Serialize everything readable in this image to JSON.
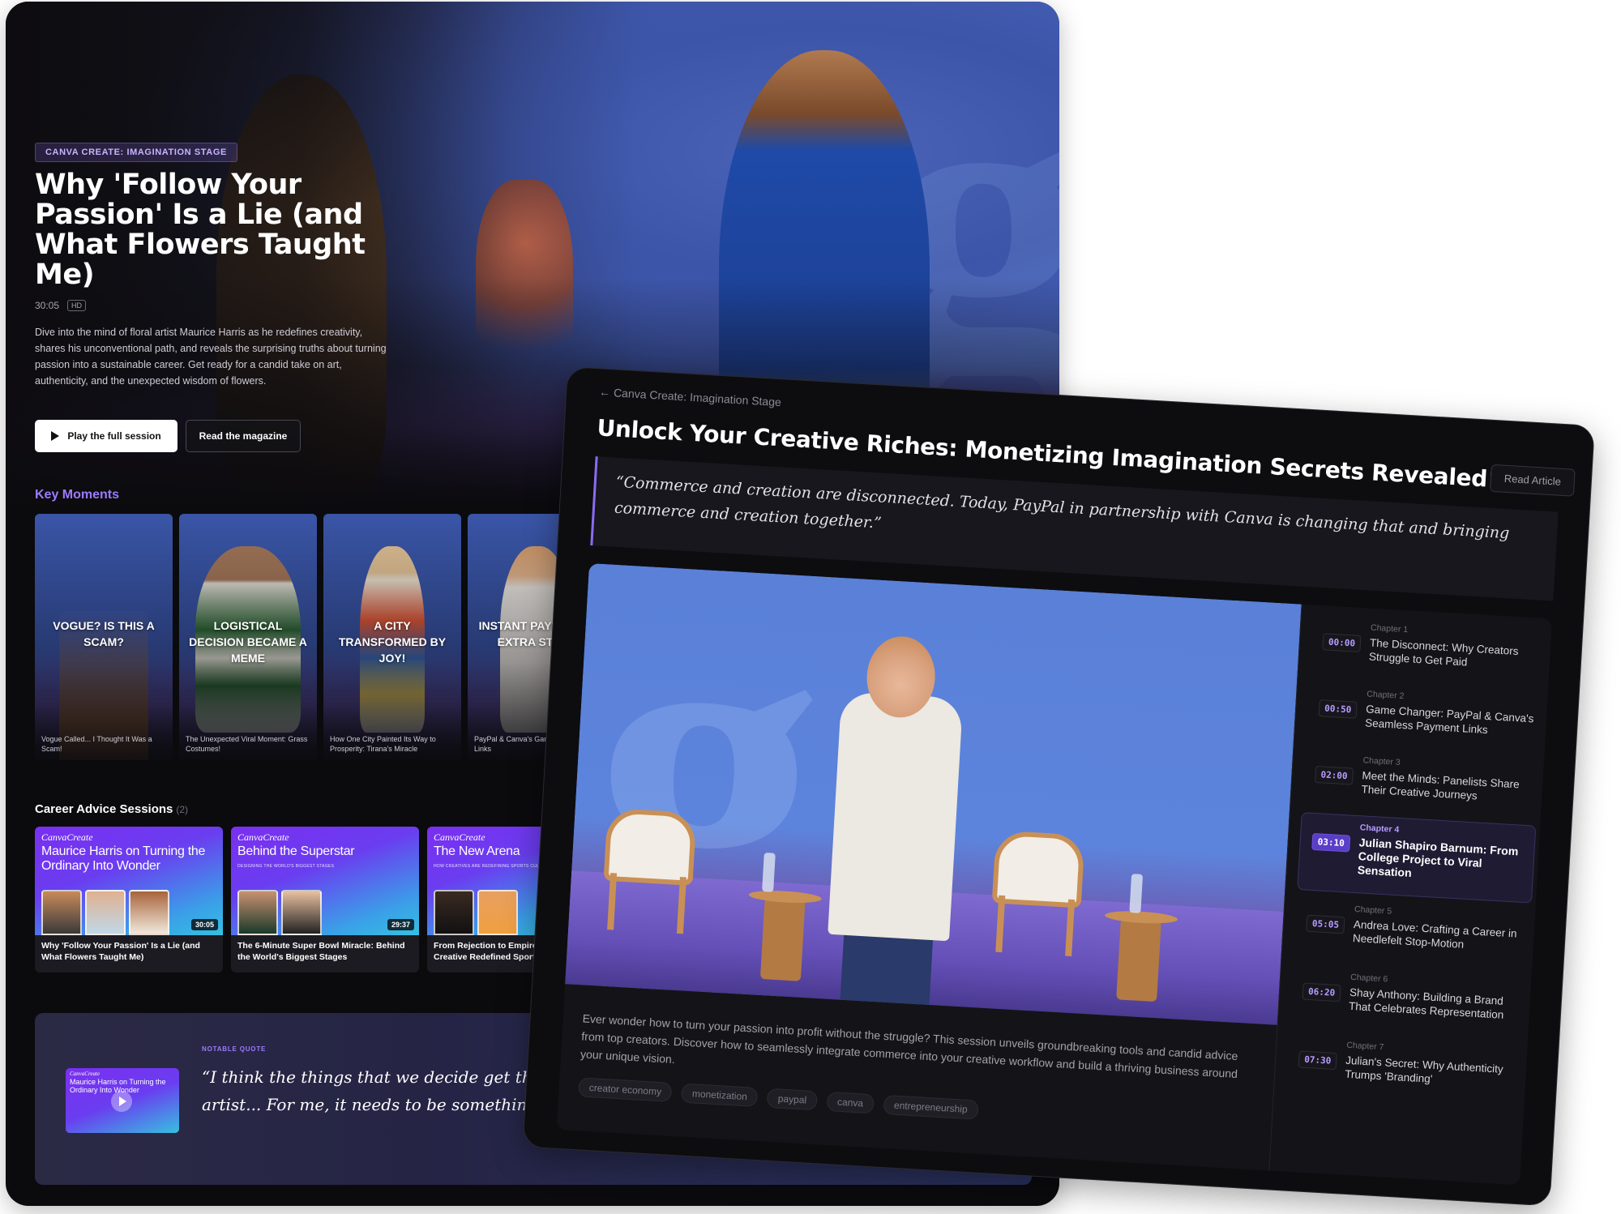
{
  "hero": {
    "tag": "CANVA CREATE: IMAGINATION STAGE",
    "title": "Why 'Follow Your Passion' Is a Lie (and What Flowers Taught Me)",
    "duration": "30:05",
    "quality": "HD",
    "description": "Dive into the mind of floral artist Maurice Harris as he redefines creativity, shares his unconventional path, and reveals the surprising truths about turning passion into a sustainable career. Get ready for a candid take on art, authenticity, and the unexpected wisdom of flowers.",
    "play_label": "Play the full session",
    "magazine_label": "Read the magazine"
  },
  "key_moments": {
    "heading": "Key Moments",
    "items": [
      {
        "title": "Vogue? Is this a scam?",
        "sub": "Vogue Called... I Thought It Was a Scam!"
      },
      {
        "title": "Logistical decision became a meme",
        "sub": "The Unexpected Viral Moment: Grass Costumes!"
      },
      {
        "title": "A city transformed by joy!",
        "sub": "How One City Painted Its Way to Prosperity: Tirana's Miracle"
      },
      {
        "title": "Instant payments, extra steps",
        "sub": "PayPal & Canva's Game Payment Links"
      }
    ]
  },
  "career_sessions": {
    "heading": "Career Advice Sessions",
    "count": "(2)",
    "items": [
      {
        "brand": "CanvaCreate",
        "thumb_title": "Maurice Harris on Turning the Ordinary Into Wonder",
        "thumb_sub": "",
        "duration": "30:05",
        "title": "Why 'Follow Your Passion' Is a Lie (and What Flowers Taught Me)"
      },
      {
        "brand": "CanvaCreate",
        "thumb_title": "Behind the Superstar",
        "thumb_sub": "DESIGNING THE WORLD'S BIGGEST STAGES",
        "duration": "29:37",
        "title": "The 6-Minute Super Bowl Miracle: Behind the World's Biggest Stages"
      },
      {
        "brand": "CanvaCreate",
        "thumb_title": "The New Arena",
        "thumb_sub": "HOW CREATIVES ARE REDEFINING SPORTS CULTURE",
        "duration": "",
        "title": "From Rejection to Empire: Creative Redefined Sports"
      }
    ]
  },
  "notable_quote": {
    "label": "NOTABLE QUOTE",
    "thumb_brand": "CanvaCreate",
    "thumb_title": "Maurice Harris on Turning the Ordinary Into Wonder",
    "text_line1": "“I think the things that we decide get the attention",
    "text_line2": "artist... For me, it needs to be something that"
  },
  "article": {
    "back_link": "← Canva Create: Imagination Stage",
    "title": "Unlock Your Creative Riches: Monetizing Imagination Secrets Revealed!",
    "read_article_label": "Read Article",
    "quote": "“Commerce and creation are disconnected. Today, PayPal in partnership with Canva is changing that and bringing commerce and creation together.”",
    "description": "Ever wonder how to turn your passion into profit without the struggle? This session unveils groundbreaking tools and candid advice from top creators. Discover how to seamlessly integrate commerce into your creative workflow and build a thriving business around your unique vision.",
    "tags": [
      "creator economy",
      "monetization",
      "paypal",
      "canva",
      "entrepreneurship"
    ],
    "chapters": [
      {
        "time": "00:00",
        "num": "Chapter 1",
        "name": "The Disconnect: Why Creators Struggle to Get Paid",
        "active": false
      },
      {
        "time": "00:50",
        "num": "Chapter 2",
        "name": "Game Changer: PayPal & Canva's Seamless Payment Links",
        "active": false
      },
      {
        "time": "02:00",
        "num": "Chapter 3",
        "name": "Meet the Minds: Panelists Share Their Creative Journeys",
        "active": false
      },
      {
        "time": "03:10",
        "num": "Chapter 4",
        "name": "Julian Shapiro Barnum: From College Project to Viral Sensation",
        "active": true
      },
      {
        "time": "05:05",
        "num": "Chapter 5",
        "name": "Andrea Love: Crafting a Career in Needlefelt Stop-Motion",
        "active": false
      },
      {
        "time": "06:20",
        "num": "Chapter 6",
        "name": "Shay Anthony: Building a Brand That Celebrates Representation",
        "active": false
      },
      {
        "time": "07:30",
        "num": "Chapter 7",
        "name": "Julian's Secret: Why Authenticity Trumps 'Branding'",
        "active": false
      }
    ]
  },
  "colors": {
    "accent": "#9b7bff",
    "active_chapter_badge": "#5a3ec8",
    "panel_bg": "#0b0a0d"
  }
}
